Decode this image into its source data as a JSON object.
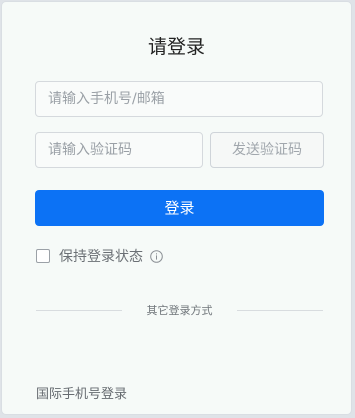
{
  "login": {
    "title": "请登录",
    "phone_placeholder": "请输入手机号/邮箱",
    "code_placeholder": "请输入验证码",
    "send_code_label": "发送验证码",
    "login_label": "登录",
    "remember_label": "保持登录状态",
    "other_methods_label": "其它登录方式",
    "intl_phone_label": "国际手机号登录"
  },
  "icons": {
    "info": "info-circle-icon"
  },
  "colors": {
    "primary": "#0c72f5"
  }
}
